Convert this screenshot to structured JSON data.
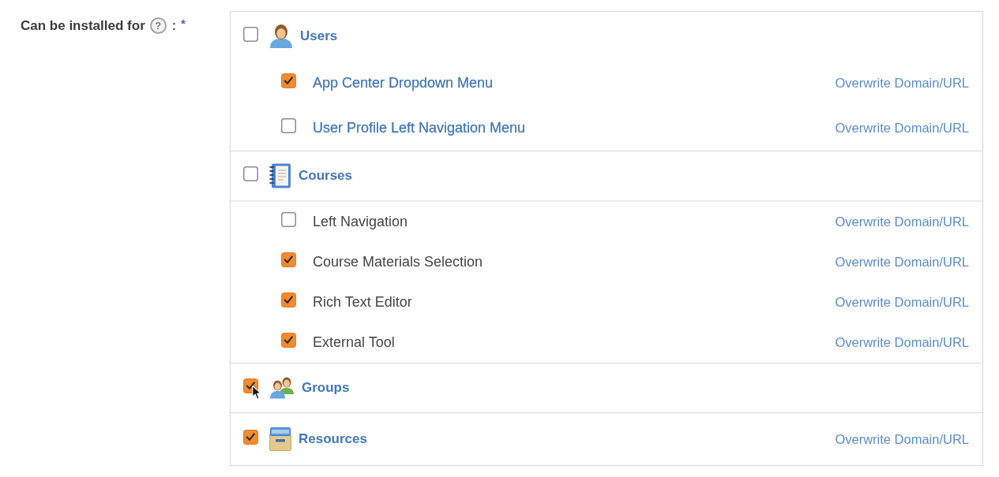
{
  "field": {
    "label": "Can be installed for",
    "help": "?",
    "separator": ":",
    "required_mark": "*"
  },
  "sections": [
    {
      "kind": "users",
      "label": "Users",
      "checked": false,
      "children": [
        {
          "kind": "link",
          "label": "App Center Dropdown Menu",
          "checked": true,
          "action": "Overwrite Domain/URL"
        },
        {
          "kind": "link",
          "label": "User Profile Left Navigation Menu",
          "checked": false,
          "action": "Overwrite Domain/URL"
        }
      ]
    },
    {
      "kind": "courses",
      "label": "Courses",
      "checked": false,
      "divided": true,
      "children": [
        {
          "kind": "text",
          "label": "Left Navigation",
          "checked": false,
          "action": "Overwrite Domain/URL"
        },
        {
          "kind": "text",
          "label": "Course Materials Selection",
          "checked": true,
          "action": "Overwrite Domain/URL"
        },
        {
          "kind": "text",
          "label": "Rich Text Editor",
          "checked": true,
          "action": "Overwrite Domain/URL"
        },
        {
          "kind": "text",
          "label": "External Tool",
          "checked": true,
          "action": "Overwrite Domain/URL"
        }
      ]
    },
    {
      "kind": "groups",
      "label": "Groups",
      "checked": true,
      "cursor": true
    },
    {
      "kind": "resources",
      "label": "Resources",
      "checked": true,
      "action": "Overwrite Domain/URL"
    }
  ]
}
